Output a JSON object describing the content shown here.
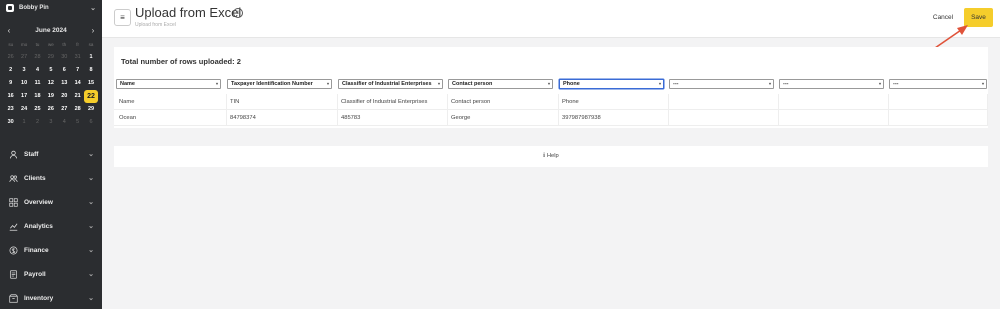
{
  "sidebar": {
    "user_name": "Bobby Pin",
    "calendar": {
      "month_label": "June 2024",
      "prev_arrow": "‹",
      "next_arrow": "›",
      "weekdays": [
        "su",
        "mo",
        "tu",
        "we",
        "th",
        "fr",
        "sa"
      ],
      "days": [
        {
          "d": "26",
          "m": true
        },
        {
          "d": "27",
          "m": true
        },
        {
          "d": "28",
          "m": true
        },
        {
          "d": "29",
          "m": true
        },
        {
          "d": "30",
          "m": true
        },
        {
          "d": "31",
          "m": true
        },
        {
          "d": "1"
        },
        {
          "d": "2"
        },
        {
          "d": "3"
        },
        {
          "d": "4"
        },
        {
          "d": "5"
        },
        {
          "d": "6"
        },
        {
          "d": "7"
        },
        {
          "d": "8"
        },
        {
          "d": "9"
        },
        {
          "d": "10"
        },
        {
          "d": "11"
        },
        {
          "d": "12"
        },
        {
          "d": "13"
        },
        {
          "d": "14"
        },
        {
          "d": "15"
        },
        {
          "d": "16"
        },
        {
          "d": "17"
        },
        {
          "d": "18"
        },
        {
          "d": "19"
        },
        {
          "d": "20"
        },
        {
          "d": "21"
        },
        {
          "d": "22",
          "today": true
        },
        {
          "d": "23"
        },
        {
          "d": "24"
        },
        {
          "d": "25"
        },
        {
          "d": "26"
        },
        {
          "d": "27"
        },
        {
          "d": "28"
        },
        {
          "d": "29"
        },
        {
          "d": "30"
        },
        {
          "d": "1",
          "m": true
        },
        {
          "d": "2",
          "m": true
        },
        {
          "d": "3",
          "m": true
        },
        {
          "d": "4",
          "m": true
        },
        {
          "d": "5",
          "m": true
        },
        {
          "d": "6",
          "m": true
        }
      ]
    },
    "menu": [
      {
        "label": "Staff",
        "icon": "person-icon"
      },
      {
        "label": "Clients",
        "icon": "people-icon"
      },
      {
        "label": "Overview",
        "icon": "grid-icon"
      },
      {
        "label": "Analytics",
        "icon": "chart-icon"
      },
      {
        "label": "Finance",
        "icon": "finance-icon"
      },
      {
        "label": "Payroll",
        "icon": "payroll-icon"
      },
      {
        "label": "Inventory",
        "icon": "inventory-icon"
      }
    ]
  },
  "header": {
    "menu_glyph": "≡",
    "title": "Upload from Excel",
    "info_glyph": "i",
    "subtitle": "Upload from Excel",
    "cancel_label": "Cancel",
    "save_label": "Save"
  },
  "upload": {
    "rows_total_label": "Total number of rows uploaded: 2",
    "columns": [
      "Name",
      "Taxpayer Identification Number",
      "Classifier of Industrial Enterprises",
      "Contact person",
      "Phone",
      "---",
      "---",
      "---"
    ],
    "active_column_index": 4,
    "rows": [
      [
        "Name",
        "TIN",
        "Classifier of Industrial Enterprises",
        "Contact person",
        "Phone",
        "",
        "",
        ""
      ],
      [
        "Ocean",
        "84798374",
        "485783",
        "George",
        "397987987938",
        "",
        "",
        ""
      ]
    ]
  },
  "help": {
    "glyph": "i",
    "label": "Help"
  },
  "colors": {
    "sidebar_bg": "#2b2d30",
    "accent": "#f5cd2b",
    "arrow": "#e0533a",
    "active_select": "#3a6bd6"
  }
}
